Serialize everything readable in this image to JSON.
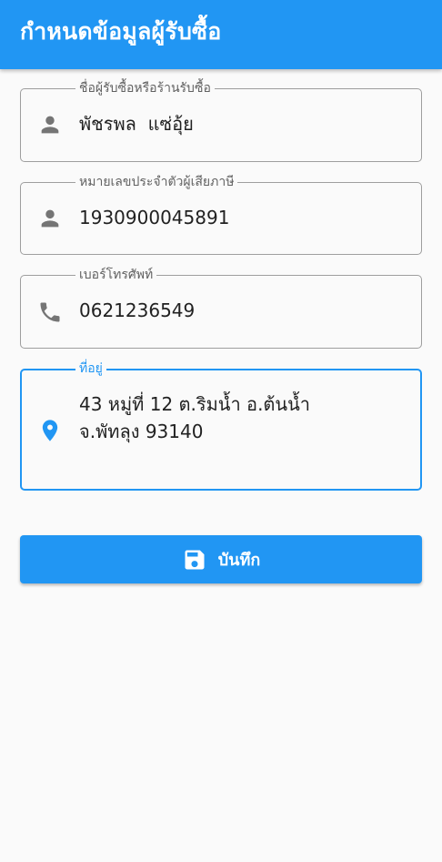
{
  "app_bar": {
    "title": "กำหนดข้อมูลผู้รับซื้อ"
  },
  "form": {
    "buyer_name": {
      "label": "ชื่อผู้รับซื้อหรือร้านรับซื้อ",
      "value": "พัชรพล  แซ่อุ้ย",
      "icon": "person-icon"
    },
    "tax_id": {
      "label": "หมายเลขประจำตัวผู้เสียภาษี",
      "value": "1930900045891",
      "icon": "person-icon"
    },
    "phone": {
      "label": "เบอร์โทรศัพท์",
      "value": "0621236549",
      "icon": "phone-icon"
    },
    "address": {
      "label": "ที่อยู่",
      "value": "43 หมู่ที่ 12 ต.ริมน้ำ อ.ต้นน้ำ\nจ.พัทลุง 93140",
      "icon": "location-pin-icon",
      "focused": true
    }
  },
  "save_button": {
    "label": "บันทึก",
    "icon": "save-icon"
  },
  "colors": {
    "primary": "#2196f3",
    "background": "#fafafa",
    "icon_gray": "#757575",
    "outline": "#9e9e9e",
    "text": "#212121"
  }
}
